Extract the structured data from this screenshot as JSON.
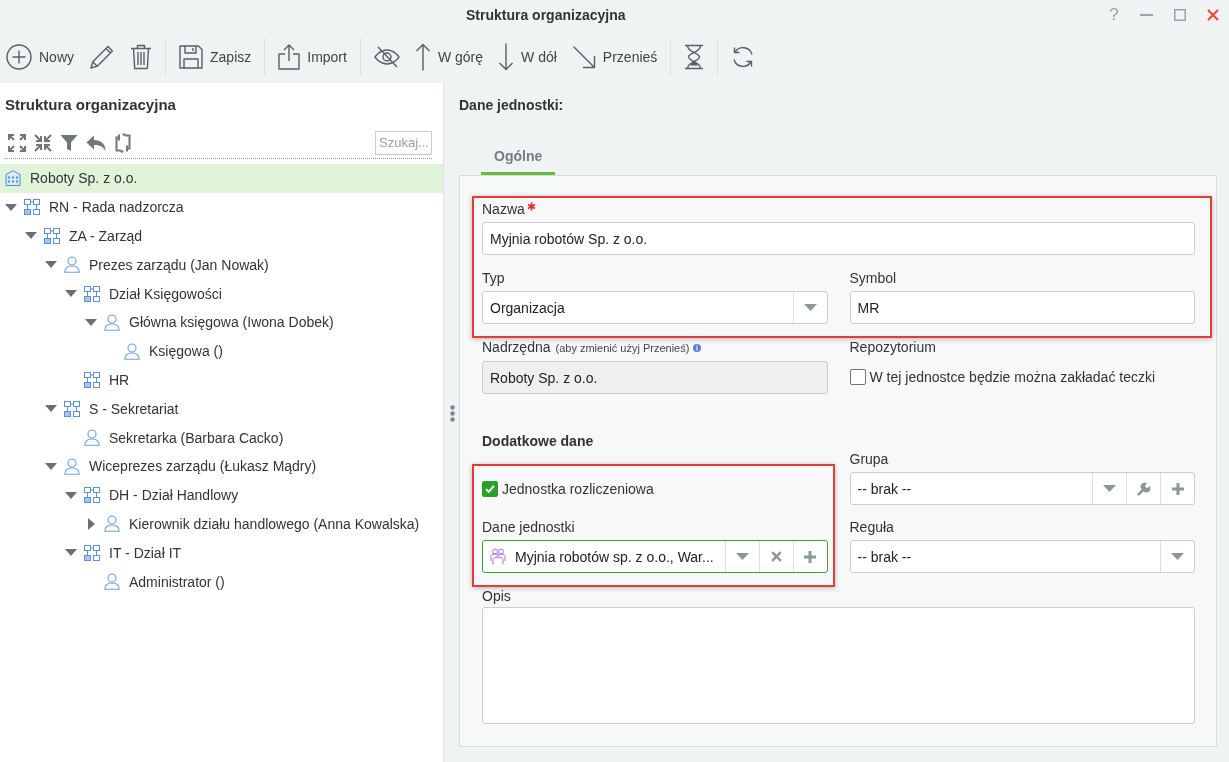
{
  "window": {
    "title": "Struktura organizacyjna",
    "help": "?"
  },
  "toolbar": [
    {
      "kind": "button",
      "label": "Nowy"
    },
    {
      "kind": "icon"
    },
    {
      "kind": "icon"
    },
    {
      "kind": "separator"
    },
    {
      "kind": "button",
      "label": "Zapisz"
    },
    {
      "kind": "separator"
    },
    {
      "kind": "button",
      "label": "Import"
    },
    {
      "kind": "separator"
    },
    {
      "kind": "icon"
    },
    {
      "kind": "button",
      "label": "W górę"
    },
    {
      "kind": "button",
      "label": "W dół"
    },
    {
      "kind": "button",
      "label": "Przenieś"
    },
    {
      "kind": "separator"
    },
    {
      "kind": "icon"
    },
    {
      "kind": "separator"
    },
    {
      "kind": "icon"
    }
  ],
  "sidebar": {
    "title": "Struktura organizacyjna",
    "search": {
      "placeholder": "Szukaj..."
    },
    "tree": [
      {
        "label": "Roboty Sp. z o.o.",
        "kind": "organization",
        "selected": true,
        "children": [
          {
            "label": "RN - Rada nadzorcza",
            "kind": "unit",
            "selected": false,
            "expanded": true,
            "children": [
              {
                "label": "ZA - Zarząd",
                "kind": "unit",
                "selected": false,
                "expanded": true,
                "children": [
                  {
                    "label": "Prezes zarządu (Jan Nowak)",
                    "kind": "person",
                    "selected": false,
                    "expanded": true,
                    "children": [
                      {
                        "label": "Dział Księgowości",
                        "kind": "unit",
                        "selected": false,
                        "expanded": true,
                        "children": [
                          {
                            "label": "Główna księgowa (Iwona Dobek)",
                            "kind": "person",
                            "selected": false,
                            "expanded": true,
                            "children": [
                              {
                                "label": "Księgowa ()",
                                "kind": "person",
                                "selected": false
                              }
                            ]
                          }
                        ]
                      },
                      {
                        "label": "HR",
                        "kind": "unit",
                        "selected": false
                      }
                    ]
                  },
                  {
                    "label": "S - Sekretariat",
                    "kind": "unit",
                    "selected": false,
                    "expanded": true,
                    "children": [
                      {
                        "label": "Sekretarka (Barbara Cacko)",
                        "kind": "person",
                        "selected": false
                      }
                    ]
                  },
                  {
                    "label": "Wiceprezes zarządu (Łukasz Mądry)",
                    "kind": "person",
                    "selected": false,
                    "expanded": true,
                    "children": [
                      {
                        "label": "DH - Dział Handlowy",
                        "kind": "unit",
                        "selected": false,
                        "expanded": true,
                        "children": [
                          {
                            "label": "Kierownik działu handlowego (Anna Kowalska)",
                            "kind": "person",
                            "selected": false,
                            "expanded": false
                          }
                        ]
                      },
                      {
                        "label": "IT - Dział IT",
                        "kind": "unit",
                        "selected": false,
                        "expanded": true,
                        "children": [
                          {
                            "label": "Administrator ()",
                            "kind": "person",
                            "selected": false
                          }
                        ]
                      }
                    ]
                  }
                ]
              }
            ]
          }
        ]
      }
    ]
  },
  "details": {
    "title": "Dane jednostki:",
    "tabs": [
      {
        "label": "Ogólne",
        "selected": true
      }
    ],
    "form": {
      "main_group": {
        "highlighted": true,
        "name": {
          "label": "Nazwa",
          "required": true,
          "value": "Myjnia robotów Sp. z o.o."
        },
        "type": {
          "label": "Typ",
          "value": "Organizacja"
        },
        "symbol": {
          "label": "Symbol",
          "value": "MR"
        }
      },
      "parent": {
        "label": "Nadrzędna",
        "note": "(aby zmienić użyj Przenieś)",
        "value": "Roboty Sp. z o.o.",
        "disabled": true
      },
      "repository": {
        "label": "Repozytorium",
        "checkbox": {
          "label": "W tej jednostce będzie można zakładać teczki",
          "checked": false
        }
      },
      "extra": {
        "title": "Dodatkowe dane",
        "billing_group": {
          "highlighted": true,
          "checkbox": {
            "label": "Jednostka rozliczeniowa",
            "checked": true
          },
          "unit_data": {
            "label": "Dane jednostki",
            "value": "Myjnia robotów sp. z o.o., War...",
            "valid": true
          }
        },
        "group": {
          "label": "Grupa",
          "value": "-- brak --"
        },
        "rule": {
          "label": "Reguła",
          "value": "-- brak --"
        }
      },
      "description": {
        "label": "Opis"
      }
    }
  }
}
